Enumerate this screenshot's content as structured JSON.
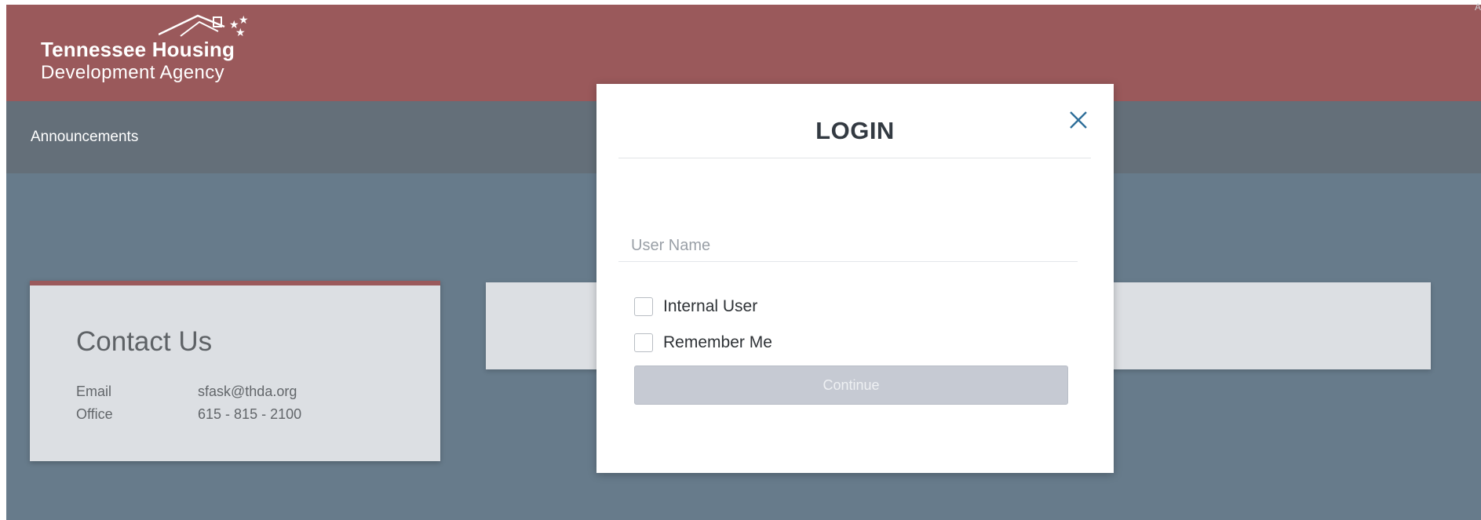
{
  "brand": {
    "line1": "Tennessee Housing",
    "line2": "Development Agency"
  },
  "corner_text": "A",
  "nav": {
    "announcements": "Announcements"
  },
  "contact": {
    "title": "Contact Us",
    "rows": [
      {
        "label": "Email",
        "value": "sfask@thda.org"
      },
      {
        "label": "Office",
        "value": "615 - 815 - 2100"
      }
    ]
  },
  "login": {
    "title": "LOGIN",
    "username_placeholder": "User Name",
    "username_value": "",
    "internal_user_label": "Internal User",
    "remember_me_label": "Remember Me",
    "continue_label": "Continue",
    "close_icon": "close-icon"
  },
  "colors": {
    "header": "#9a595b",
    "navbar": "#646f79",
    "backdrop": "#677b8b",
    "card": "#dcdfe3",
    "button_disabled": "#c6cad3",
    "close_icon": "#2f6f9a"
  }
}
